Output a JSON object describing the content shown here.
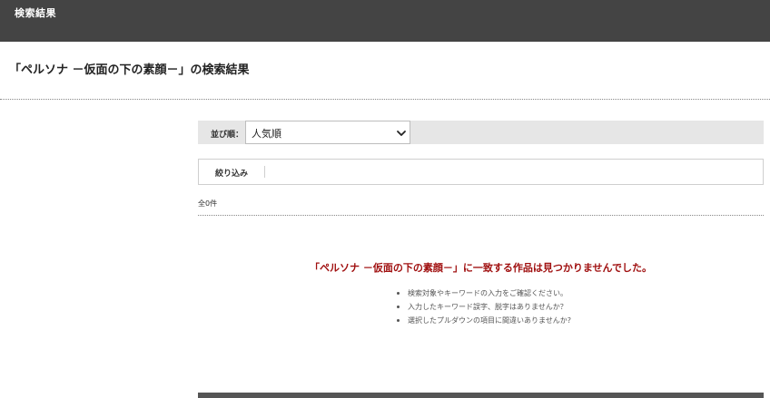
{
  "header": {
    "title": "検索結果"
  },
  "page": {
    "title": "「ペルソナ －仮面の下の素顔－」の検索結果"
  },
  "sort": {
    "label": "並び順：",
    "selected": "人気順",
    "icon": "chevron-down-icon"
  },
  "filter": {
    "label": "絞り込み"
  },
  "results": {
    "count_text": "全0件"
  },
  "no_results": {
    "message": "「ペルソナ －仮面の下の素顔－」に一致する作品は見つかりませんでした。",
    "hints": [
      "検索対象やキーワードの入力をご確認ください。",
      "入力したキーワード誤字、脱字はありませんか？",
      "選択したプルダウンの項目に間違いありませんか?"
    ]
  },
  "colors": {
    "header_bg": "#444444",
    "sortbar_bg": "#e6e6e6",
    "message_red": "#a01010"
  }
}
